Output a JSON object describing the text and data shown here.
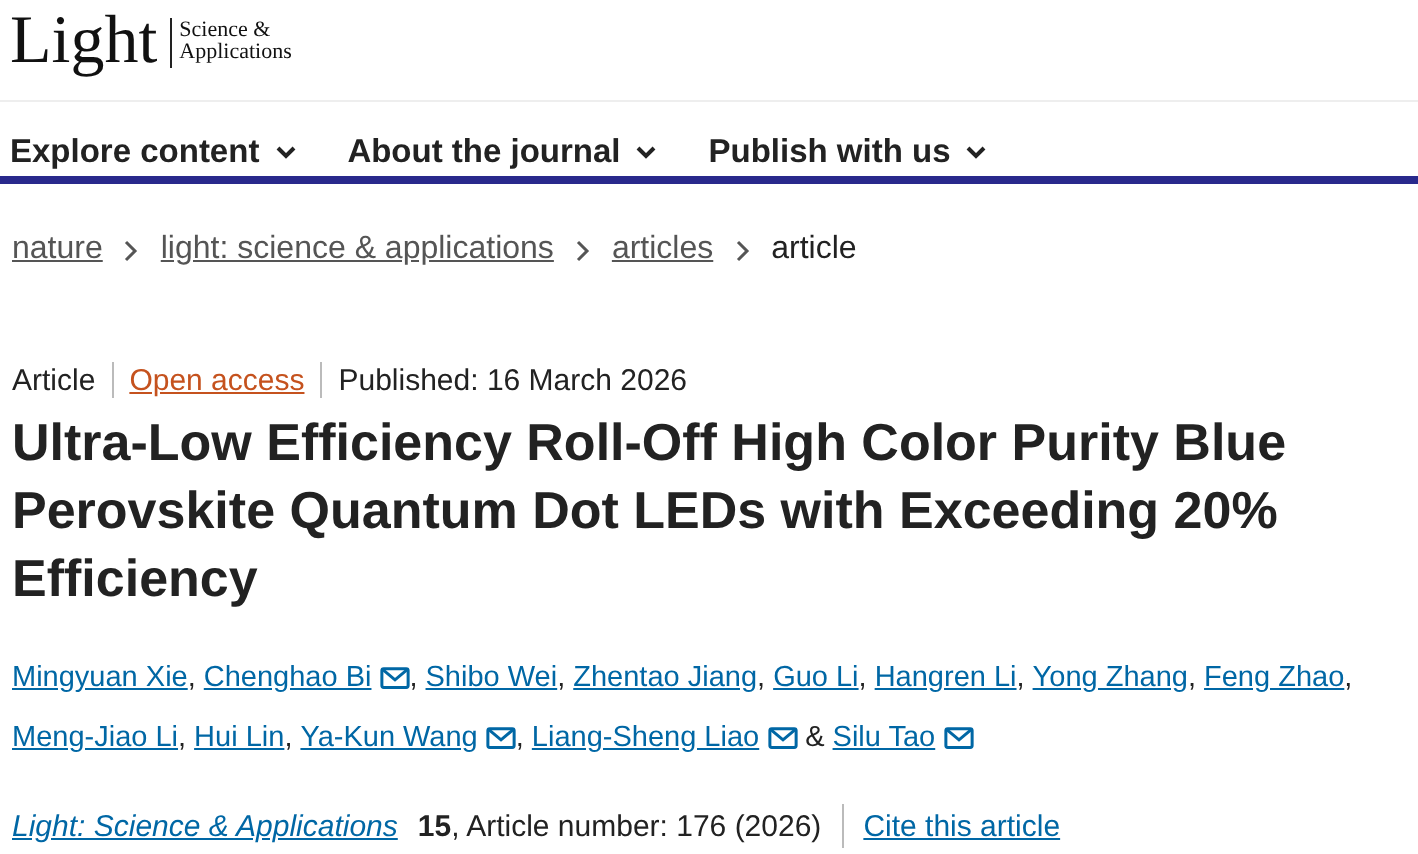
{
  "logo": {
    "name": "Light",
    "subtitle_lines": [
      "Science &",
      "Applications"
    ]
  },
  "nav": [
    {
      "label": "Explore content"
    },
    {
      "label": "About the journal"
    },
    {
      "label": "Publish with us"
    }
  ],
  "breadcrumbs": [
    {
      "label": "nature",
      "current": false
    },
    {
      "label": "light: science & applications",
      "current": false
    },
    {
      "label": "articles",
      "current": false
    },
    {
      "label": "article",
      "current": true
    }
  ],
  "meta": {
    "type": "Article",
    "access": "Open access",
    "published": "Published: 16 March 2026"
  },
  "title": "Ultra-Low Efficiency Roll-Off High Color Purity Blue Perovskite Quantum Dot LEDs with Exceeding 20% Efficiency",
  "author_lines": [
    [
      {
        "name": "Mingyuan Xie",
        "email": false,
        "joiner": ","
      },
      {
        "name": "Chenghao Bi",
        "email": true,
        "joiner": ","
      },
      {
        "name": "Shibo Wei",
        "email": false,
        "joiner": ","
      },
      {
        "name": "Zhentao Jiang",
        "email": false,
        "joiner": ","
      },
      {
        "name": "Guo Li",
        "email": false,
        "joiner": ","
      },
      {
        "name": "Hangren Li",
        "email": false,
        "joiner": ","
      },
      {
        "name": "Yong Zhang",
        "email": false,
        "joiner": ","
      },
      {
        "name": "Feng Zhao",
        "email": false,
        "joiner": ","
      }
    ],
    [
      {
        "name": "Meng-Jiao Li",
        "email": false,
        "joiner": ","
      },
      {
        "name": "Hui Lin",
        "email": false,
        "joiner": ","
      },
      {
        "name": "Ya-Kun Wang",
        "email": true,
        "joiner": ","
      },
      {
        "name": "Liang-Sheng Liao",
        "email": true,
        "joiner": "&"
      },
      {
        "name": "Silu Tao",
        "email": true
      }
    ]
  ],
  "citation": {
    "journal": "Light: Science & Applications",
    "volume": "15",
    "details": ", Article number: 176 (2026)",
    "cite_link": "Cite this article"
  }
}
